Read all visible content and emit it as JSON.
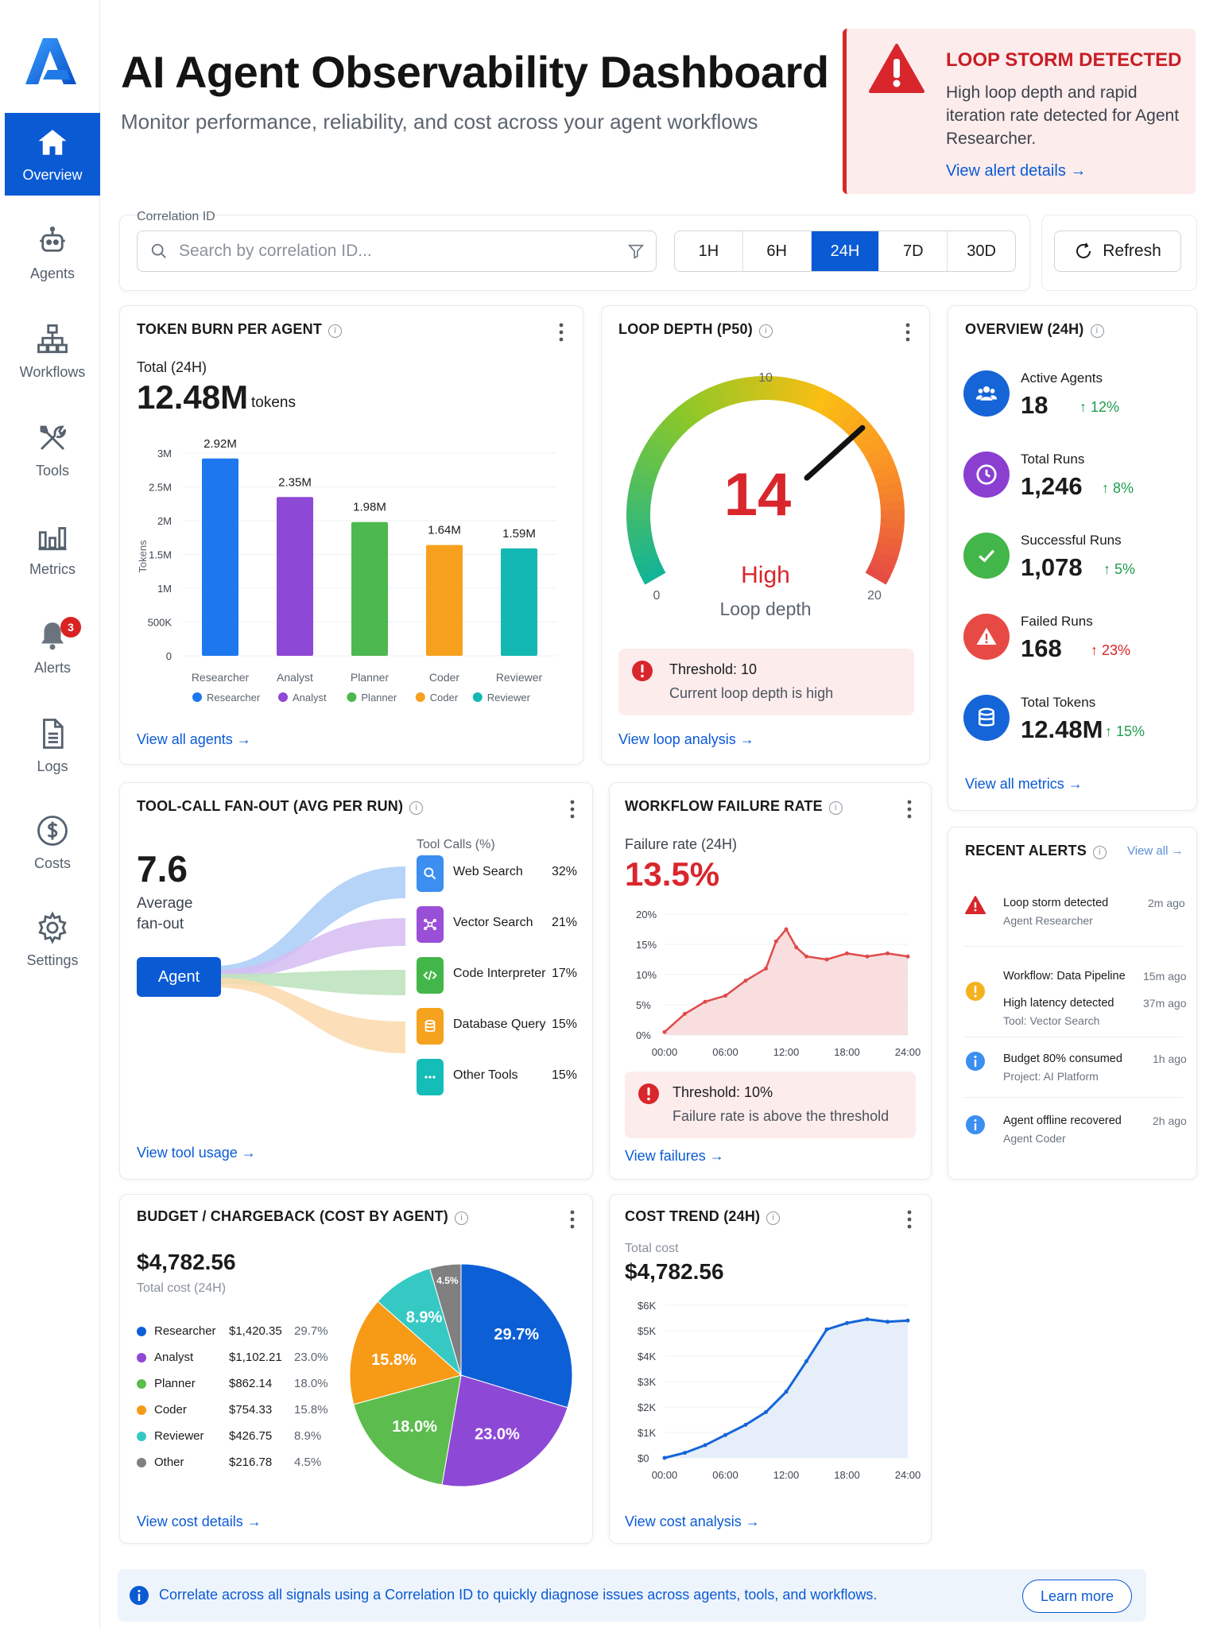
{
  "nav": {
    "items": [
      {
        "label": "Overview",
        "icon": "home-icon",
        "active": true
      },
      {
        "label": "Agents",
        "icon": "robot-icon"
      },
      {
        "label": "Workflows",
        "icon": "workflow-icon"
      },
      {
        "label": "Tools",
        "icon": "tools-icon"
      },
      {
        "label": "Metrics",
        "icon": "bar-chart-icon"
      },
      {
        "label": "Alerts",
        "icon": "bell-icon",
        "badge": "3"
      },
      {
        "label": "Logs",
        "icon": "document-icon"
      },
      {
        "label": "Costs",
        "icon": "dollar-icon"
      },
      {
        "label": "Settings",
        "icon": "gear-icon"
      }
    ]
  },
  "header": {
    "title": "AI Agent Observability Dashboard",
    "subtitle": "Monitor performance, reliability, and cost across your agent workflows"
  },
  "loop_alert": {
    "title": "LOOP STORM DETECTED",
    "message": "High loop depth and rapid iteration rate detected for Agent Researcher.",
    "link": "View alert details →"
  },
  "filters": {
    "correlation_label": "Correlation ID",
    "search_placeholder": "Search by correlation ID...",
    "time_ranges": [
      "1H",
      "6H",
      "24H",
      "7D",
      "30D"
    ],
    "selected_range": "24H",
    "refresh_label": "Refresh"
  },
  "token_burn": {
    "title": "TOKEN BURN PER AGENT",
    "total_label": "Total (24H)",
    "total_value": "12.48M",
    "total_unit": "tokens",
    "link": "View all agents →"
  },
  "loop_depth": {
    "title": "LOOP DEPTH (P50)",
    "value": "14",
    "status": "High",
    "caption": "Loop depth",
    "min": "0",
    "mid": "10",
    "max": "20",
    "threshold_title": "Threshold: 10",
    "threshold_msg": "Current loop depth is high",
    "link": "View loop analysis →"
  },
  "overview": {
    "title": "OVERVIEW (24H)",
    "metrics": [
      {
        "label": "Active Agents",
        "value": "18",
        "delta": "↑ 12%",
        "color": "#1565d8",
        "delta_color": "#1e9e4b",
        "icon": "people-icon"
      },
      {
        "label": "Total Runs",
        "value": "1,246",
        "delta": "↑ 8%",
        "color": "#8a3fd1",
        "delta_color": "#1e9e4b",
        "icon": "clock-icon"
      },
      {
        "label": "Successful Runs",
        "value": "1,078",
        "delta": "↑ 5%",
        "color": "#43b649",
        "delta_color": "#1e9e4b",
        "icon": "check-icon"
      },
      {
        "label": "Failed Runs",
        "value": "168",
        "delta": "↑ 23%",
        "color": "#e74a44",
        "delta_color": "#d92323",
        "icon": "warning-icon"
      },
      {
        "label": "Total Tokens",
        "value": "12.48M",
        "delta": "↑ 15%",
        "color": "#1565d8",
        "delta_color": "#1e9e4b",
        "icon": "database-icon"
      }
    ],
    "link": "View all metrics →"
  },
  "fanout": {
    "title": "TOOL-CALL FAN-OUT (AVG PER RUN)",
    "value": "7.6",
    "caption_line1": "Average",
    "caption_line2": "fan-out",
    "agent_label": "Agent",
    "tools_header": "Tool Calls (%)",
    "tools": [
      {
        "name": "Web Search",
        "pct": "32%",
        "color": "#3c8ef0",
        "icon": "search-icon"
      },
      {
        "name": "Vector Search",
        "pct": "21%",
        "color": "#9a4fd8",
        "icon": "vector-icon"
      },
      {
        "name": "Code Interpreter",
        "pct": "17%",
        "color": "#43b649",
        "icon": "code-icon"
      },
      {
        "name": "Database Query",
        "pct": "15%",
        "color": "#f5a21f",
        "icon": "database-icon"
      },
      {
        "name": "Other Tools",
        "pct": "15%",
        "color": "#14bdb8",
        "icon": "more-icon"
      }
    ],
    "link": "View tool usage →"
  },
  "failure": {
    "title": "WORKFLOW FAILURE RATE",
    "rate_label": "Failure rate (24H)",
    "rate_value": "13.5%",
    "threshold_title": "Threshold: 10%",
    "threshold_msg": "Failure rate is above the threshold",
    "link": "View failures →"
  },
  "recent_alerts": {
    "title": "RECENT ALERTS",
    "view_all": "View all →",
    "items": [
      {
        "title": "Loop storm detected",
        "sub": "Agent Researcher",
        "time": "2m ago",
        "level": "error"
      },
      {
        "title": "Workflow: Data Pipeline",
        "sub": "",
        "time": "15m ago",
        "level": "warning",
        "extra_title": "High latency detected",
        "extra_sub": "Tool: Vector Search",
        "extra_time": "37m ago"
      },
      {
        "title": "Budget 80% consumed",
        "sub": "Project: AI Platform",
        "time": "1h ago",
        "level": "info"
      },
      {
        "title": "Agent offline recovered",
        "sub": "Agent Coder",
        "time": "2h ago",
        "level": "info"
      }
    ]
  },
  "budget": {
    "title": "BUDGET / CHARGEBACK (COST BY AGENT)",
    "total": "$4,782.56",
    "total_label": "Total cost (24H)",
    "link": "View cost details →"
  },
  "cost_trend": {
    "title": "COST TREND (24H)",
    "total_label": "Total cost",
    "total": "$4,782.56",
    "link": "View cost analysis →"
  },
  "footer": {
    "text": "Correlate across all signals using a Correlation ID to quickly diagnose issues across agents, tools, and workflows.",
    "button": "Learn more"
  },
  "chart_data": [
    {
      "type": "bar",
      "title": "TOKEN BURN PER AGENT",
      "categories": [
        "Researcher",
        "Analyst",
        "Planner",
        "Coder",
        "Reviewer"
      ],
      "values": [
        2920000,
        2350000,
        1980000,
        1640000,
        1590000
      ],
      "data_labels": [
        "2.92M",
        "2.35M",
        "1.98M",
        "1.64M",
        "1.59M"
      ],
      "colors": [
        "#1d78f0",
        "#8e48d6",
        "#4cb84f",
        "#f7a01e",
        "#14b8b2"
      ],
      "ylabel": "Tokens",
      "yticks": [
        "0",
        "500K",
        "1M",
        "1.5M",
        "2M",
        "2.5M",
        "3M"
      ],
      "ylim": [
        0,
        3000000
      ],
      "legend": "bottom"
    },
    {
      "type": "line",
      "title": "WORKFLOW FAILURE RATE",
      "x": [
        "00:00",
        "02:00",
        "04:00",
        "06:00",
        "08:00",
        "10:00",
        "11:00",
        "12:00",
        "13:00",
        "14:00",
        "16:00",
        "18:00",
        "20:00",
        "22:00",
        "24:00"
      ],
      "values": [
        0.5,
        3.5,
        5.5,
        6.5,
        9.0,
        11.0,
        15.5,
        17.5,
        14.5,
        13.0,
        12.5,
        13.5,
        13.0,
        13.5,
        13.0
      ],
      "xticks": [
        "00:00",
        "06:00",
        "12:00",
        "18:00",
        "24:00"
      ],
      "yticks": [
        "0%",
        "5%",
        "10%",
        "15%",
        "20%"
      ],
      "ylim": [
        0,
        20
      ],
      "color": "#e04a4a"
    },
    {
      "type": "pie",
      "title": "BUDGET / CHARGEBACK (COST BY AGENT)",
      "series": [
        {
          "name": "Researcher",
          "value": 1420.35,
          "amount": "$1,420.35",
          "pct": "29.7%",
          "color": "#0d5fd6"
        },
        {
          "name": "Analyst",
          "value": 1102.21,
          "amount": "$1,102.21",
          "pct": "23.0%",
          "color": "#8e48d6"
        },
        {
          "name": "Planner",
          "value": 862.14,
          "amount": "$862.14",
          "pct": "18.0%",
          "color": "#5cbd4e"
        },
        {
          "name": "Coder",
          "value": 754.33,
          "amount": "$754.33",
          "pct": "15.8%",
          "color": "#f79a16"
        },
        {
          "name": "Reviewer",
          "value": 426.75,
          "amount": "$426.75",
          "pct": "8.9%",
          "color": "#36c9c4"
        },
        {
          "name": "Other",
          "value": 216.78,
          "amount": "$216.78",
          "pct": "4.5%",
          "color": "#808080"
        }
      ]
    },
    {
      "type": "area",
      "title": "COST TREND (24H)",
      "x": [
        "00:00",
        "02:00",
        "04:00",
        "06:00",
        "08:00",
        "10:00",
        "12:00",
        "14:00",
        "16:00",
        "18:00",
        "20:00",
        "22:00",
        "24:00"
      ],
      "values": [
        0,
        200,
        500,
        900,
        1300,
        1800,
        2600,
        3800,
        5050,
        5300,
        5450,
        5350,
        5400
      ],
      "xticks": [
        "00:00",
        "06:00",
        "12:00",
        "18:00",
        "24:00"
      ],
      "yticks": [
        "$0",
        "$1K",
        "$2K",
        "$3K",
        "$4K",
        "$5K",
        "$6K"
      ],
      "ylim": [
        0,
        6000
      ],
      "color": "#1565d8"
    }
  ]
}
